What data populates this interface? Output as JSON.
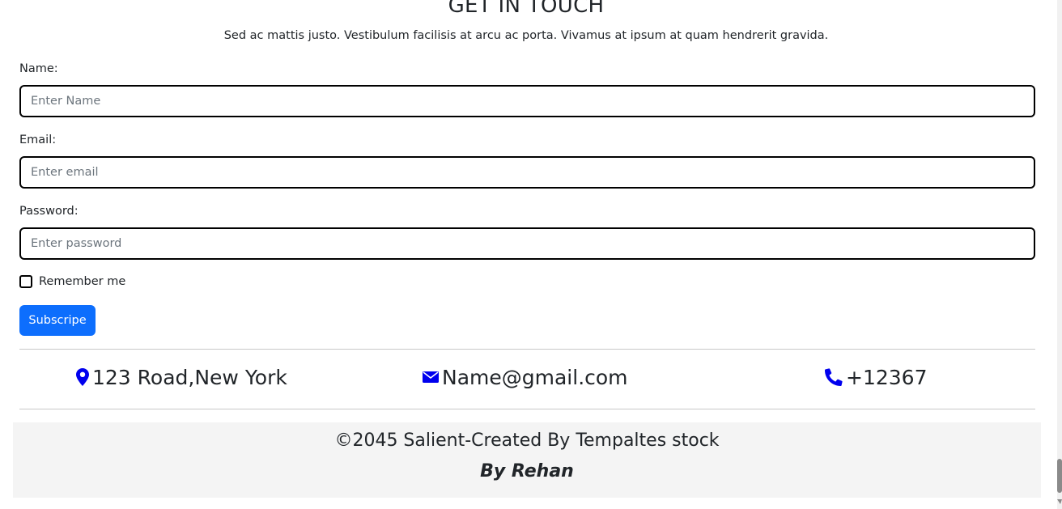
{
  "header": {
    "title": "GET IN TOUCH",
    "subtitle": "Sed ac mattis justo. Vestibulum facilisis at arcu ac porta. Vivamus at ipsum at quam hendrerit gravida."
  },
  "form": {
    "name_label": "Name:",
    "name_placeholder": "Enter Name",
    "email_label": "Email:",
    "email_placeholder": "Enter email",
    "password_label": "Password:",
    "password_placeholder": "Enter password",
    "remember_label": "Remember me",
    "remember_checked": false,
    "submit_label": "Subscripe"
  },
  "contact": {
    "address": "123 Road,New York",
    "email": "Name@gmail.com",
    "phone": "+12367",
    "icon_color": "#0000ee"
  },
  "footer": {
    "copyright": "©2045 Salient-Created By Tempaltes stock",
    "author": "By Rehan"
  },
  "colors": {
    "accent": "#0d6efd",
    "footer_bg": "#f4f4f4"
  },
  "icons": [
    "map-marker-icon",
    "envelope-icon",
    "phone-icon"
  ]
}
